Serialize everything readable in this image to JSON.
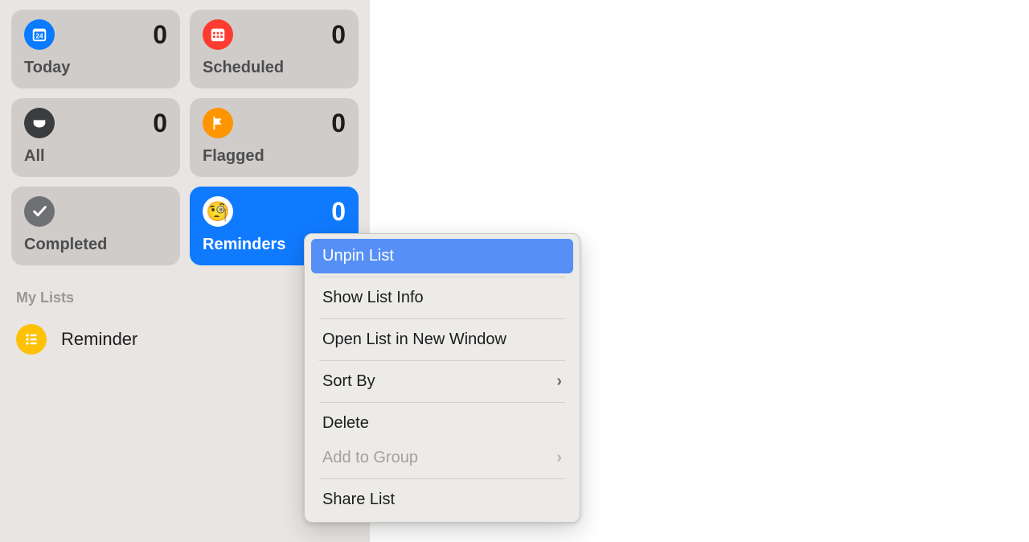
{
  "sidebar": {
    "smart": {
      "today": {
        "label": "Today",
        "count": "0"
      },
      "scheduled": {
        "label": "Scheduled",
        "count": "0"
      },
      "all": {
        "label": "All",
        "count": "0"
      },
      "flagged": {
        "label": "Flagged",
        "count": "0"
      },
      "completed": {
        "label": "Completed"
      },
      "reminders": {
        "label": "Reminders",
        "count": "0",
        "emoji": "🧐"
      }
    },
    "sectionHeader": "My Lists",
    "lists": [
      {
        "label": "Reminder"
      }
    ]
  },
  "contextMenu": {
    "unpin": "Unpin List",
    "info": "Show List Info",
    "openNew": "Open List in New Window",
    "sortBy": "Sort By",
    "delete": "Delete",
    "addGroup": "Add to Group",
    "share": "Share List"
  },
  "colors": {
    "accent": "#107aff",
    "highlight": "#5690f6"
  }
}
